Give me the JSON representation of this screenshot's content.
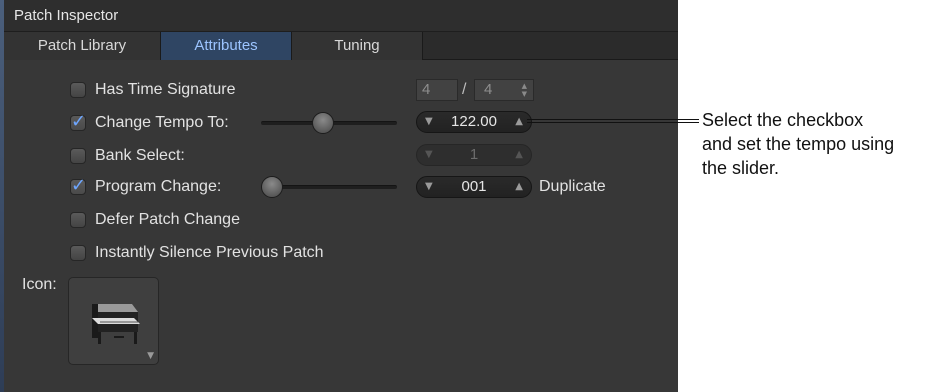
{
  "window": {
    "title": "Patch Inspector"
  },
  "tabs": [
    {
      "label": "Patch Library",
      "active": false
    },
    {
      "label": "Attributes",
      "active": true
    },
    {
      "label": "Tuning",
      "active": false
    }
  ],
  "options": {
    "time_signature": {
      "label": "Has Time Signature",
      "checked": false,
      "numerator": "4",
      "separator": "/",
      "denominator": "4"
    },
    "change_tempo": {
      "label": "Change Tempo To:",
      "checked": true,
      "value": "122.00",
      "slider_fraction": 0.45
    },
    "bank_select": {
      "label": "Bank Select:",
      "checked": false,
      "value": "1"
    },
    "program_change": {
      "label": "Program Change:",
      "checked": true,
      "value": "001",
      "slider_fraction": 0.0,
      "extra_label": "Duplicate"
    },
    "defer_patch_change": {
      "label": "Defer Patch Change",
      "checked": false
    },
    "instantly_silence": {
      "label": "Instantly Silence Previous Patch",
      "checked": false
    }
  },
  "icon": {
    "label": "Icon:",
    "image": "piano-icon"
  },
  "glyphs": {
    "check": "✓",
    "arrow_down": "▼",
    "arrow_up": "▲",
    "dropdown": "▼"
  },
  "callout": {
    "lines": [
      "Select the checkbox",
      "and set the tempo using",
      "the slider."
    ]
  },
  "colors": {
    "accent": "#6ea6ff",
    "active_tab": "#2f4563",
    "panel": "#373737"
  }
}
